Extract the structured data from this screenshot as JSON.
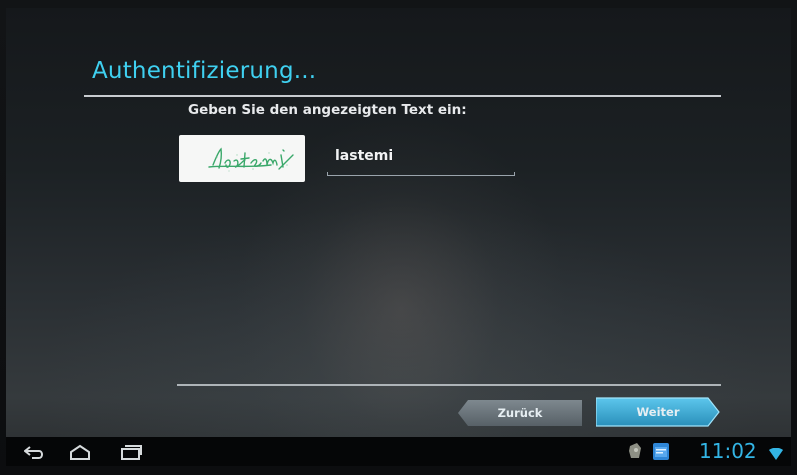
{
  "dialog": {
    "title": "Authentifizierung...",
    "instruction": "Geben Sie den angezeigten Text ein:",
    "captcha_text": "lastemi",
    "input_value": "lastemi"
  },
  "buttons": {
    "back_label": "Zurück",
    "next_label": "Weiter"
  },
  "statusbar": {
    "nav_icons": [
      "back-icon",
      "home-icon",
      "recent-apps-icon"
    ],
    "notification_icons": [
      "app-notification-icon",
      "calendar-notification-icon"
    ],
    "time": "11:02",
    "signal_icon": "wifi-icon"
  },
  "colors": {
    "title": "#3fd0f0",
    "clock": "#33b5e5",
    "button_back": "#6e7a82",
    "button_next": "#3aa8d4"
  }
}
